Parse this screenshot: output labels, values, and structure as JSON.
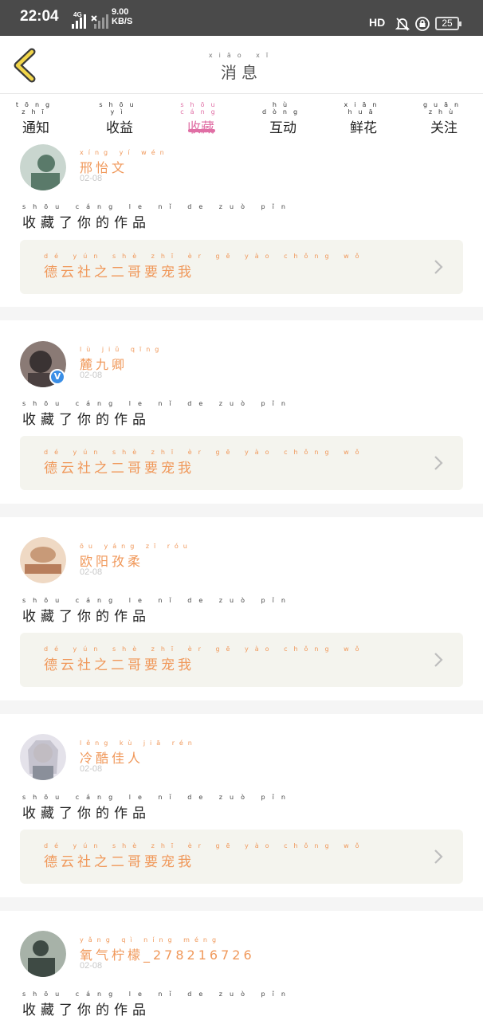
{
  "status_bar": {
    "time": "22:04",
    "network": "4G",
    "speed_value": "9.00",
    "speed_unit": "KB/S",
    "hd": "HD",
    "battery": "25"
  },
  "header": {
    "title": "消息",
    "title_pinyin": "xiāo xī"
  },
  "tabs": [
    {
      "label": "通知",
      "pinyin": "tōng zhī",
      "active": false
    },
    {
      "label": "收益",
      "pinyin": "shōu yì",
      "active": false
    },
    {
      "label": "收藏",
      "pinyin": "shōu cáng",
      "active": true
    },
    {
      "label": "互动",
      "pinyin": "hù dòng",
      "active": false
    },
    {
      "label": "鲜花",
      "pinyin": "xiān huā",
      "active": false
    },
    {
      "label": "关注",
      "pinyin": "guān zhù",
      "active": false
    }
  ],
  "feed": [
    {
      "username": "邢怡文",
      "username_pinyin": "xíng yí wén",
      "date": "02-08",
      "action": "收藏了你的作品",
      "action_pinyin": "shōu cáng le nǐ de zuò pǐn",
      "work_title": "德云社之二哥要宠我",
      "work_pinyin": "dé yún shè zhī èr gē yào chǒng wǒ",
      "verified": false,
      "avatar_colors": [
        "#5a7a6a",
        "#c9d6cf"
      ]
    },
    {
      "username": "麓九卿",
      "username_pinyin": "lù jiǔ qīng",
      "date": "02-08",
      "action": "收藏了你的作品",
      "action_pinyin": "shōu cáng le nǐ de zuò pǐn",
      "work_title": "德云社之二哥要宠我",
      "work_pinyin": "dé yún shè zhī èr gē yào chǒng wǒ",
      "verified": true,
      "avatar_colors": [
        "#3a3333",
        "#8a7a75"
      ]
    },
    {
      "username": "欧阳孜柔",
      "username_pinyin": "ōu yáng zī róu",
      "date": "02-08",
      "action": "收藏了你的作品",
      "action_pinyin": "shōu cáng le nǐ de zuò pǐn",
      "work_title": "德云社之二哥要宠我",
      "work_pinyin": "dé yún shè zhī èr gē yào chǒng wǒ",
      "verified": false,
      "avatar_colors": [
        "#c89a78",
        "#efd9c4"
      ]
    },
    {
      "username": "冷酷佳人",
      "username_pinyin": "lěng kù jiā rén",
      "date": "02-08",
      "action": "收藏了你的作品",
      "action_pinyin": "shōu cáng le nǐ de zuò pǐn",
      "work_title": "德云社之二哥要宠我",
      "work_pinyin": "dé yún shè zhī èr gē yào chǒng wǒ",
      "verified": false,
      "avatar_colors": [
        "#8a8f9a",
        "#e4e2ea"
      ]
    },
    {
      "username": "氧气柠檬_278216726",
      "username_pinyin": "yǎng qì níng méng",
      "date": "02-08",
      "action": "收藏了你的作品",
      "action_pinyin": "shōu cáng le nǐ de zuò pǐn",
      "work_title": "",
      "work_pinyin": "",
      "verified": false,
      "avatar_colors": [
        "#3e4a44",
        "#a7b2a8"
      ]
    }
  ],
  "colors": {
    "accent_pink": "#e06fa5",
    "accent_orange": "#f0985a",
    "card_bg": "#f4f4ee",
    "status_bar": "#4a4a4a"
  }
}
